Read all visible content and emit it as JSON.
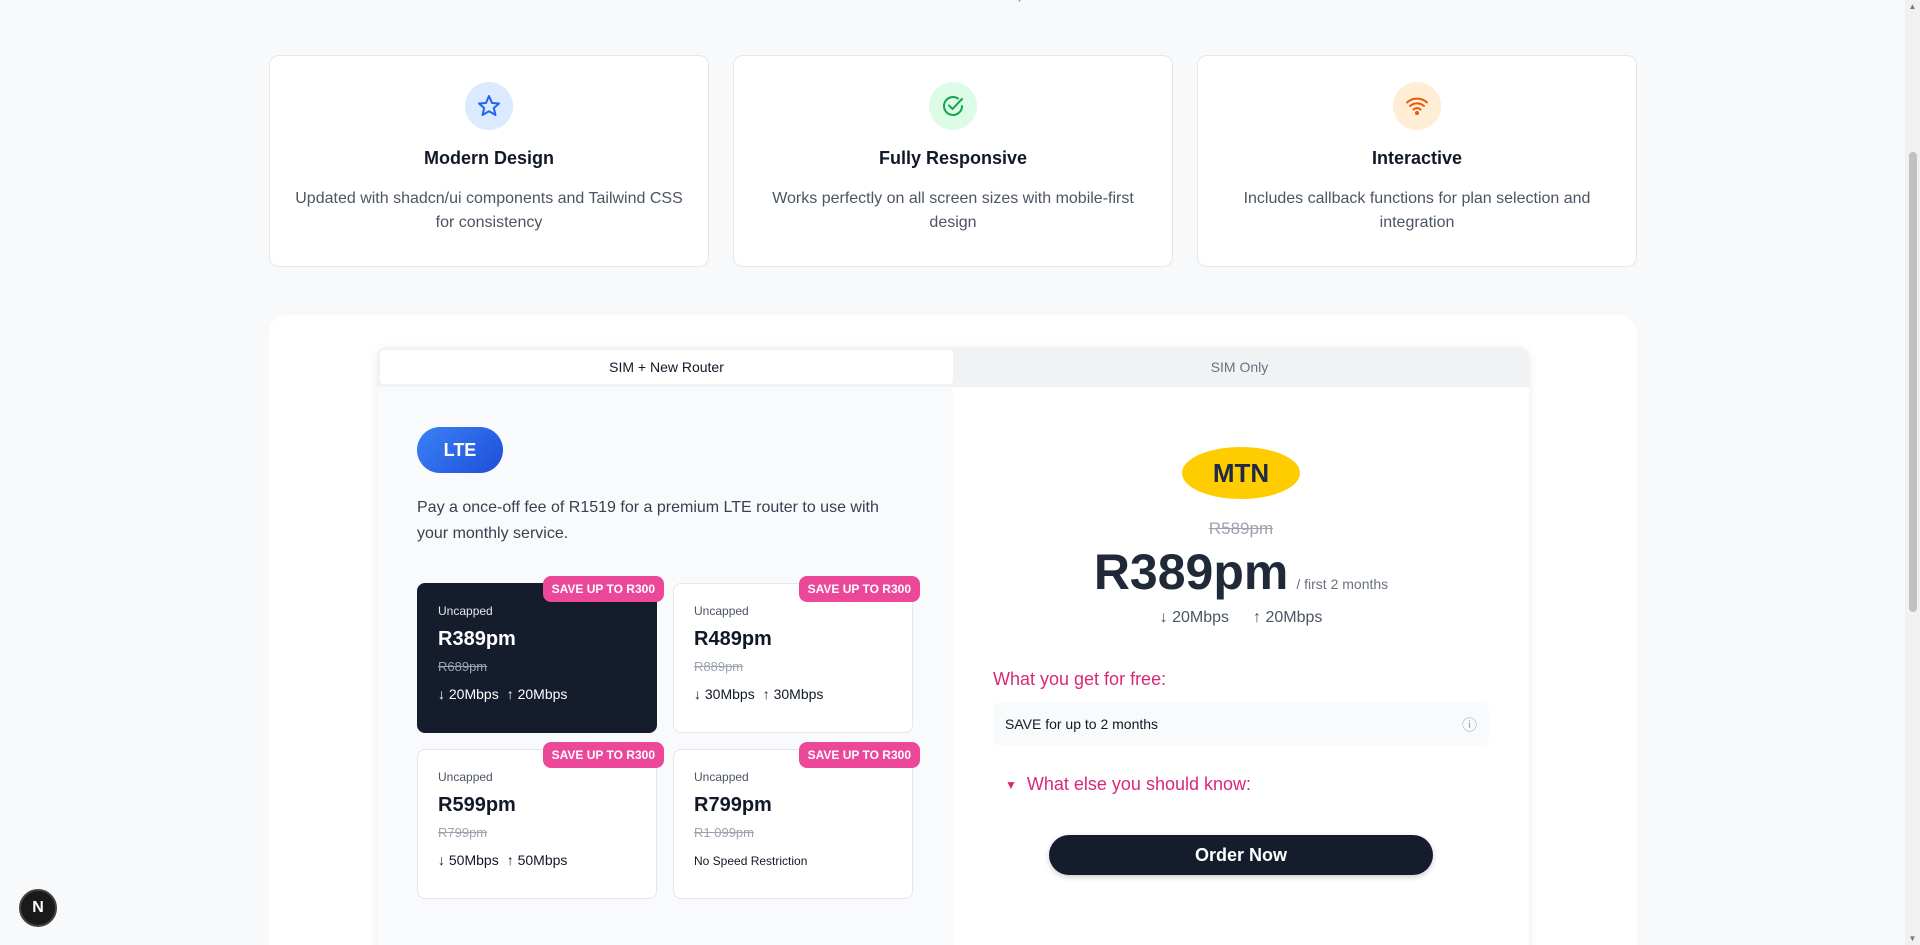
{
  "features": [
    {
      "icon": "star-icon",
      "title": "Modern Design",
      "desc": "Updated with shadcn/ui components and Tailwind CSS for consistency"
    },
    {
      "icon": "check-circle-icon",
      "title": "Fully Responsive",
      "desc": "Works perfectly on all screen sizes with mobile-first design"
    },
    {
      "icon": "wifi-icon",
      "title": "Interactive",
      "desc": "Includes callback functions for plan selection and integration"
    }
  ],
  "tabs": [
    "SIM + New Router",
    "SIM Only"
  ],
  "left": {
    "badge": "LTE",
    "desc": "Pay a once-off fee of R1519 for a premium LTE router to use with your monthly service."
  },
  "plans": [
    {
      "badge": "SAVE UP TO R300",
      "type": "Uncapped",
      "price": "R389pm",
      "old": "R689pm",
      "down": "↓ 20Mbps",
      "up": "↑ 20Mbps"
    },
    {
      "badge": "SAVE UP TO R300",
      "type": "Uncapped",
      "price": "R489pm",
      "old": "R889pm",
      "down": "↓ 30Mbps",
      "up": "↑ 30Mbps"
    },
    {
      "badge": "SAVE UP TO R300",
      "type": "Uncapped",
      "price": "R599pm",
      "old": "R799pm",
      "down": "↓ 50Mbps",
      "up": "↑ 50Mbps"
    },
    {
      "badge": "SAVE UP TO R300",
      "type": "Uncapped",
      "price": "R799pm",
      "old": "R1 099pm",
      "note": "No Speed Restriction"
    }
  ],
  "right": {
    "logo": "MTN",
    "old_price": "R589pm",
    "price": "R389pm",
    "period": "/ first 2 months",
    "down": "↓ 20Mbps",
    "up": "↑ 20Mbps",
    "free_title": "What you get for free:",
    "free_item": "SAVE for up to 2 months",
    "info_icon": "ⓘ",
    "know_arrow": "▼",
    "know_title": "What else you should know:",
    "order_label": "Order Now"
  },
  "next_badge": "N",
  "colors": {
    "accent": "#db2777",
    "dark": "#151c2c",
    "badge": "#ec4899",
    "mtn": "#ffcc00"
  }
}
